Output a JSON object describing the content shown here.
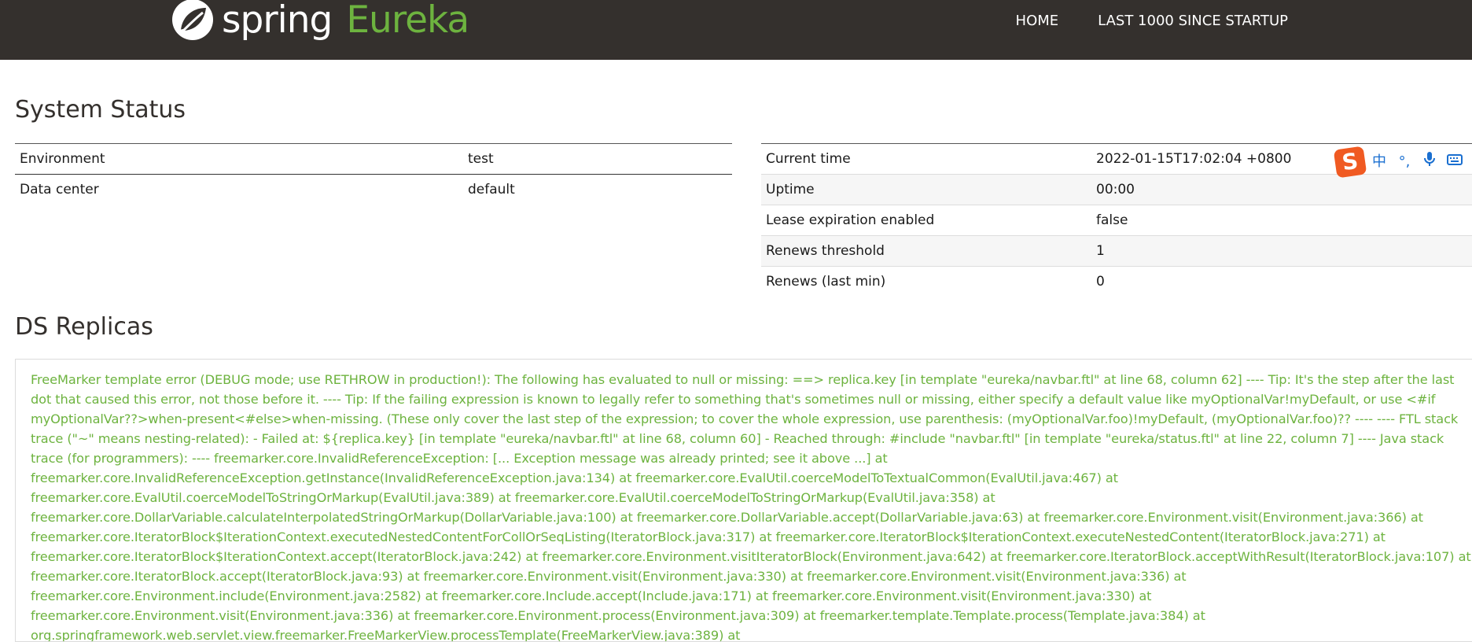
{
  "header": {
    "brand_primary": "spring",
    "brand_secondary": "Eureka",
    "nav": [
      {
        "label": "HOME"
      },
      {
        "label": "LAST 1000 SINCE STARTUP"
      }
    ]
  },
  "system_status": {
    "title": "System Status",
    "left_rows": [
      {
        "key": "Environment",
        "value": "test"
      },
      {
        "key": "Data center",
        "value": "default"
      }
    ],
    "right_rows": [
      {
        "key": "Current time",
        "value": "2022-01-15T17:02:04 +0800"
      },
      {
        "key": "Uptime",
        "value": "00:00"
      },
      {
        "key": "Lease expiration enabled",
        "value": "false"
      },
      {
        "key": "Renews threshold",
        "value": "1"
      },
      {
        "key": "Renews (last min)",
        "value": "0"
      }
    ]
  },
  "ime_toolbar": {
    "logo": "S",
    "items": [
      {
        "icon": "chinese-mode-icon",
        "glyph": "中"
      },
      {
        "icon": "punctuation-icon",
        "glyph": "°,"
      },
      {
        "icon": "microphone-icon",
        "glyph": "🎤"
      },
      {
        "icon": "keyboard-icon",
        "glyph": "⌨"
      },
      {
        "icon": "tools-icon",
        "glyph": "👕"
      }
    ]
  },
  "ds_replicas": {
    "title": "DS Replicas",
    "error_text": "FreeMarker template error (DEBUG mode; use RETHROW in production!): The following has evaluated to null or missing: ==> replica.key [in template \"eureka/navbar.ftl\" at line 68, column 62] ---- Tip: It's the step after the last dot that caused this error, not those before it. ---- Tip: If the failing expression is known to legally refer to something that's sometimes null or missing, either specify a default value like myOptionalVar!myDefault, or use <#if myOptionalVar??>when-present<#else>when-missing. (These only cover the last step of the expression; to cover the whole expression, use parenthesis: (myOptionalVar.foo)!myDefault, (myOptionalVar.foo)?? ---- ---- FTL stack trace (\"~\" means nesting-related): - Failed at: ${replica.key} [in template \"eureka/navbar.ftl\" at line 68, column 60] - Reached through: #include \"navbar.ftl\" [in template \"eureka/status.ftl\" at line 22, column 7] ---- Java stack trace (for programmers): ---- freemarker.core.InvalidReferenceException: [... Exception message was already printed; see it above ...] at freemarker.core.InvalidReferenceException.getInstance(InvalidReferenceException.java:134) at freemarker.core.EvalUtil.coerceModelToTextualCommon(EvalUtil.java:467) at freemarker.core.EvalUtil.coerceModelToStringOrMarkup(EvalUtil.java:389) at freemarker.core.EvalUtil.coerceModelToStringOrMarkup(EvalUtil.java:358) at freemarker.core.DollarVariable.calculateInterpolatedStringOrMarkup(DollarVariable.java:100) at freemarker.core.DollarVariable.accept(DollarVariable.java:63) at freemarker.core.Environment.visit(Environment.java:366) at freemarker.core.IteratorBlock$IterationContext.executedNestedContentForCollOrSeqListing(IteratorBlock.java:317) at freemarker.core.IteratorBlock$IterationContext.executeNestedContent(IteratorBlock.java:271) at freemarker.core.IteratorBlock$IterationContext.accept(IteratorBlock.java:242) at freemarker.core.Environment.visitIteratorBlock(Environment.java:642) at freemarker.core.IteratorBlock.acceptWithResult(IteratorBlock.java:107) at freemarker.core.IteratorBlock.accept(IteratorBlock.java:93) at freemarker.core.Environment.visit(Environment.java:330) at freemarker.core.Environment.visit(Environment.java:336) at freemarker.core.Environment.include(Environment.java:2582) at freemarker.core.Include.accept(Include.java:171) at freemarker.core.Environment.visit(Environment.java:330) at freemarker.core.Environment.visit(Environment.java:336) at freemarker.core.Environment.process(Environment.java:309) at freemarker.template.Template.process(Template.java:384) at org.springframework.web.servlet.view.freemarker.FreeMarkerView.processTemplate(FreeMarkerView.java:389) at"
  },
  "colors": {
    "header_bg": "#34302d",
    "spring_green": "#6db33f",
    "ime_orange": "#f05a22",
    "ime_blue": "#1a6fd0"
  }
}
